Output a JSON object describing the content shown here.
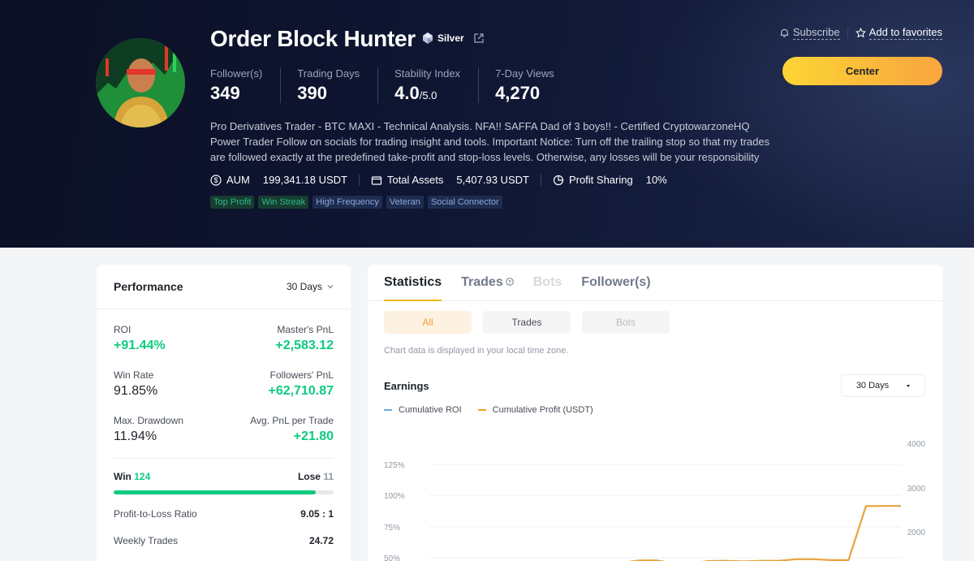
{
  "profile": {
    "name": "Order Block Hunter",
    "tier": "Silver",
    "stats": [
      {
        "label": "Follower(s)",
        "value": "349"
      },
      {
        "label": "Trading Days",
        "value": "390"
      },
      {
        "label": "Stability Index",
        "value": "4.0",
        "suffix": "/5.0"
      },
      {
        "label": "7-Day Views",
        "value": "4,270"
      }
    ],
    "bio": "Pro Derivatives Trader - BTC MAXI - Technical Analysis. NFA!! SAFFA Dad of 3 boys!! - Certified CryptowarzoneHQ Power Trader Follow on socials for trading insight and tools. Important Notice: Turn off the trailing stop so that my trades are followed exactly at the predefined take-profit and stop-loss levels. Otherwise, any losses will be your responsibility",
    "aum_label": "AUM",
    "aum_value": "199,341.18 USDT",
    "total_assets_label": "Total Assets",
    "total_assets_value": "5,407.93 USDT",
    "profit_sharing_label": "Profit Sharing",
    "profit_sharing_value": "10%",
    "tags": [
      "Top Profit",
      "Win Streak",
      "High Frequency",
      "Veteran",
      "Social Connector"
    ]
  },
  "actions": {
    "subscribe": "Subscribe",
    "favorites": "Add to favorites",
    "center": "Center"
  },
  "performance": {
    "title": "Performance",
    "period": "30 Days",
    "roi_label": "ROI",
    "roi_value": "+91.44%",
    "master_pnl_label": "Master's PnL",
    "master_pnl_value": "+2,583.12",
    "win_rate_label": "Win Rate",
    "win_rate_value": "91.85%",
    "followers_pnl_label": "Followers' PnL",
    "followers_pnl_value": "+62,710.87",
    "max_drawdown_label": "Max. Drawdown",
    "max_drawdown_value": "11.94%",
    "avg_pnl_label": "Avg. PnL per Trade",
    "avg_pnl_value": "+21.80",
    "win_label": "Win",
    "win_count": "124",
    "lose_label": "Lose",
    "lose_count": "11",
    "win_fraction": 0.9185,
    "ptl_label": "Profit-to-Loss Ratio",
    "ptl_value": "9.05 : 1",
    "weekly_label": "Weekly Trades",
    "weekly_value": "24.72"
  },
  "statistics": {
    "tabs": [
      "Statistics",
      "Trades",
      "Bots",
      "Follower(s)"
    ],
    "filters": [
      "All",
      "Trades",
      "Bots"
    ],
    "note": "Chart data is displayed in your local time zone.",
    "earnings_title": "Earnings",
    "earnings_period": "30 Days",
    "legend": [
      {
        "name": "Cumulative ROI",
        "color": "#6ea8e6"
      },
      {
        "name": "Cumulative Profit (USDT)",
        "color": "#f0a030"
      }
    ]
  },
  "chart_data": {
    "type": "line",
    "left_axis_ticks": [
      "125%",
      "100%",
      "75%",
      "50%"
    ],
    "right_axis_ticks": [
      "4000",
      "3000",
      "2000"
    ],
    "series": [
      {
        "name": "Cumulative Profit (USDT)",
        "axis": "right",
        "values": [
          1290,
          1300,
          1350,
          1355,
          1290,
          1290,
          1340,
          1345,
          1330,
          1345,
          1345,
          1380,
          1380,
          1360,
          1360,
          2580,
          2583,
          2583
        ]
      }
    ]
  }
}
